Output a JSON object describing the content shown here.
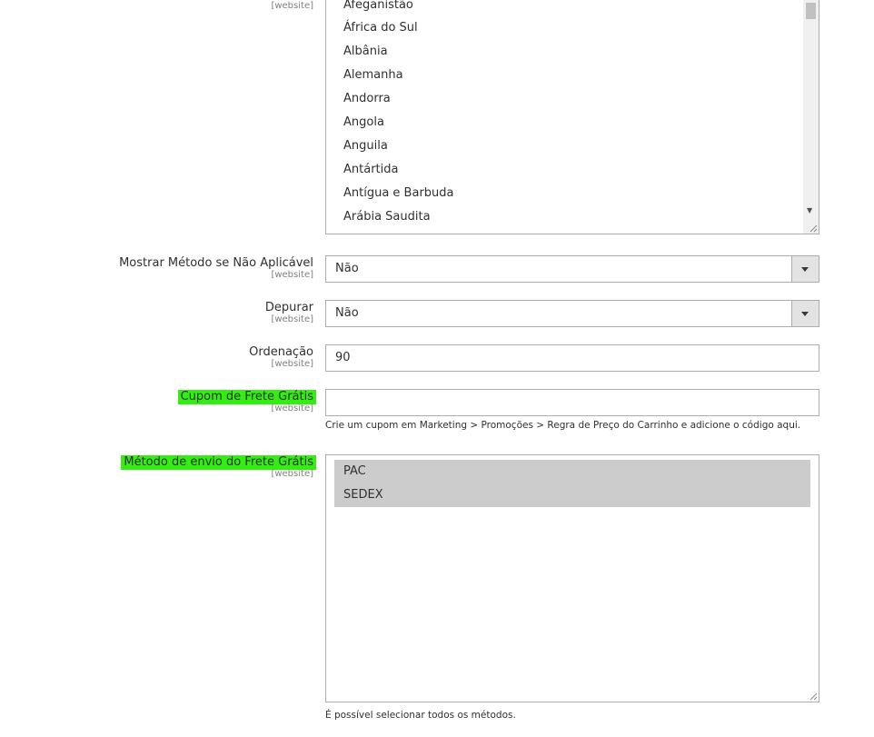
{
  "countries_field": {
    "scope": "[website]",
    "options": [
      "Afeganistão",
      "África do Sul",
      "Albânia",
      "Alemanha",
      "Andorra",
      "Angola",
      "Anguila",
      "Antártida",
      "Antígua e Barbuda",
      "Arábia Saudita"
    ]
  },
  "show_method": {
    "label": "Mostrar Método se Não Aplicável",
    "scope": "[website]",
    "value": "Não"
  },
  "debug": {
    "label": "Depurar",
    "scope": "[website]",
    "value": "Não"
  },
  "sort_order": {
    "label": "Ordenação",
    "scope": "[website]",
    "value": "90"
  },
  "free_coupon": {
    "label": "Cupom de Frete Grátis",
    "scope": "[website]",
    "value": "",
    "note": "Crie um cupom em Marketing > Promoções > Regra de Preço do Carrinho e adicione o código aqui."
  },
  "free_method": {
    "label": "Método de envio do Frete Grátis",
    "scope": "[website]",
    "options": [
      "PAC",
      "SEDEX"
    ],
    "note": "É possível selecionar todos os métodos."
  },
  "colors": {
    "highlight": "#33ee11",
    "selected_option": "#cccccc",
    "border": "#adadad"
  }
}
